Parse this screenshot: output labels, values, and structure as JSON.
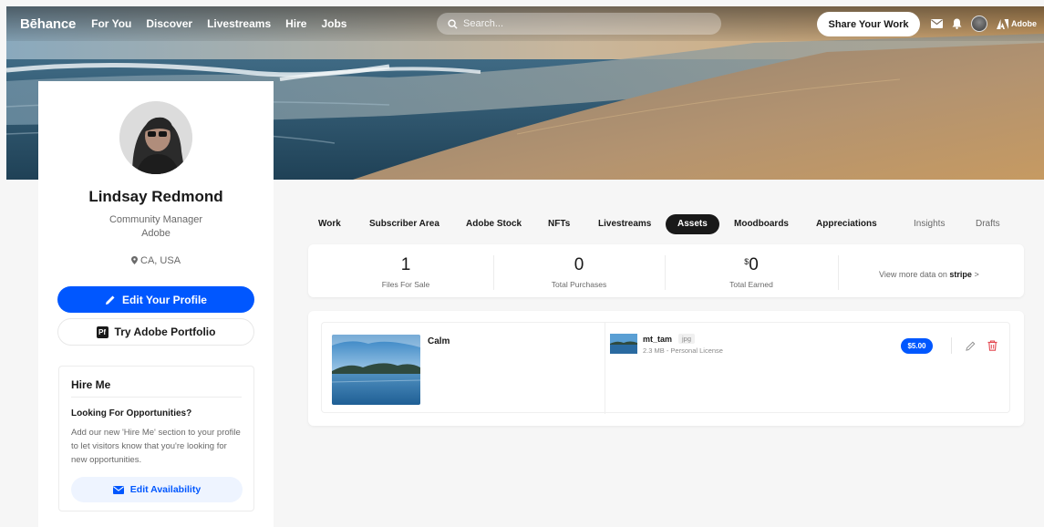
{
  "nav": {
    "logo": "Bēhance",
    "links": [
      "For You",
      "Discover",
      "Livestreams",
      "Hire",
      "Jobs"
    ],
    "search_placeholder": "Search...",
    "share_label": "Share Your Work",
    "adobe_label": "Adobe"
  },
  "profile": {
    "name": "Lindsay Redmond",
    "role": "Community Manager",
    "company": "Adobe",
    "location": "CA, USA",
    "edit_label": "Edit Your Profile",
    "portfolio_badge": "Pf",
    "portfolio_label": "Try Adobe Portfolio"
  },
  "hire": {
    "title": "Hire Me",
    "subtitle": "Looking For Opportunities?",
    "description": "Add our new 'Hire Me' section to your profile to let visitors know that you're looking for new opportunities.",
    "button_label": "Edit Availability"
  },
  "tabs": [
    {
      "label": "Work"
    },
    {
      "label": "Subscriber Area"
    },
    {
      "label": "Adobe Stock"
    },
    {
      "label": "NFTs"
    },
    {
      "label": "Livestreams"
    },
    {
      "label": "Assets",
      "active": true
    },
    {
      "label": "Moodboards"
    },
    {
      "label": "Appreciations"
    },
    {
      "label": "Insights"
    },
    {
      "label": "Drafts"
    }
  ],
  "stats": {
    "files_value": "1",
    "files_label": "Files For Sale",
    "purchases_value": "0",
    "purchases_label": "Total Purchases",
    "earned_currency": "$",
    "earned_value": "0",
    "earned_label": "Total Earned",
    "stripe_prefix": "View more data on",
    "stripe_brand": "stripe",
    "stripe_arrow": ">"
  },
  "asset": {
    "title": "Calm",
    "file_name": "mt_tam",
    "file_ext": "jpg",
    "file_meta": "2.3 MB - Personal License",
    "price": "$5.00"
  },
  "colors": {
    "accent": "#0057ff",
    "delete": "#e34850"
  }
}
